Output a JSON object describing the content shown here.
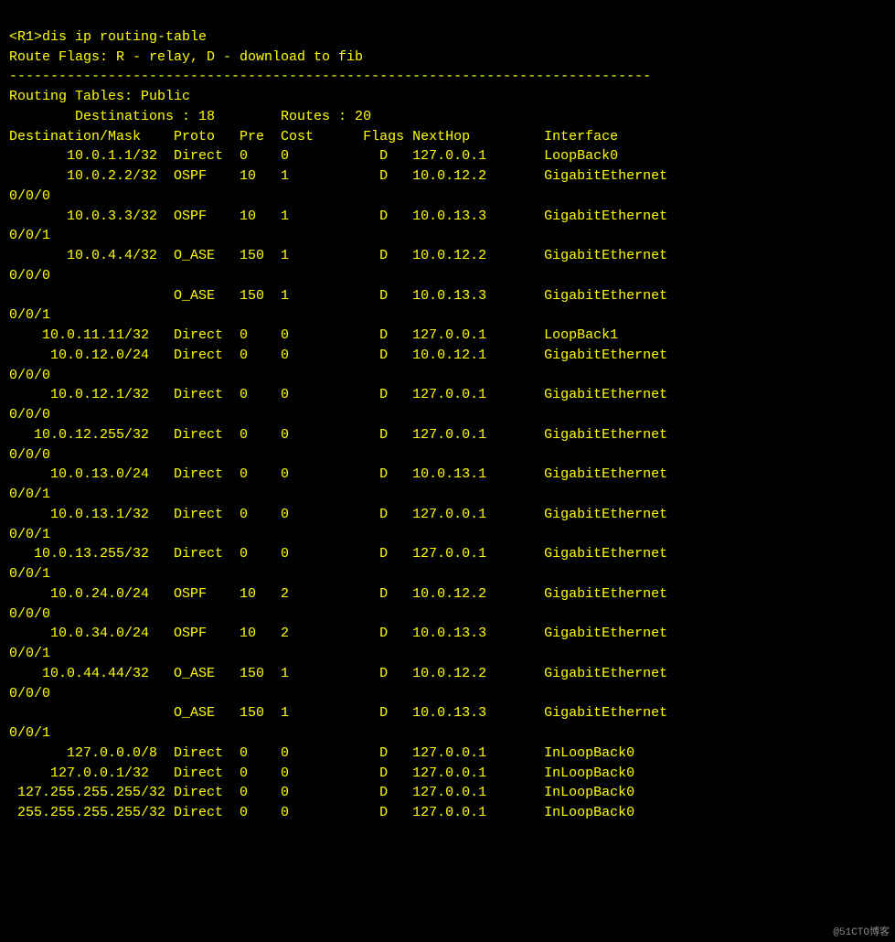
{
  "terminal": {
    "lines": [
      "<R1>dis ip routing-table",
      "Route Flags: R - relay, D - download to fib",
      "------------------------------------------------------------------------------",
      "Routing Tables: Public",
      "        Destinations : 18        Routes : 20",
      "",
      "Destination/Mask    Proto   Pre  Cost      Flags NextHop         Interface",
      "",
      "       10.0.1.1/32  Direct  0    0           D   127.0.0.1       LoopBack0",
      "       10.0.2.2/32  OSPF    10   1           D   10.0.12.2       GigabitEthernet",
      "0/0/0",
      "       10.0.3.3/32  OSPF    10   1           D   10.0.13.3       GigabitEthernet",
      "0/0/1",
      "       10.0.4.4/32  O_ASE   150  1           D   10.0.12.2       GigabitEthernet",
      "0/0/0",
      "                    O_ASE   150  1           D   10.0.13.3       GigabitEthernet",
      "0/0/1",
      "    10.0.11.11/32   Direct  0    0           D   127.0.0.1       LoopBack1",
      "     10.0.12.0/24   Direct  0    0           D   10.0.12.1       GigabitEthernet",
      "0/0/0",
      "     10.0.12.1/32   Direct  0    0           D   127.0.0.1       GigabitEthernet",
      "0/0/0",
      "   10.0.12.255/32   Direct  0    0           D   127.0.0.1       GigabitEthernet",
      "0/0/0",
      "     10.0.13.0/24   Direct  0    0           D   10.0.13.1       GigabitEthernet",
      "0/0/1",
      "     10.0.13.1/32   Direct  0    0           D   127.0.0.1       GigabitEthernet",
      "0/0/1",
      "   10.0.13.255/32   Direct  0    0           D   127.0.0.1       GigabitEthernet",
      "0/0/1",
      "     10.0.24.0/24   OSPF    10   2           D   10.0.12.2       GigabitEthernet",
      "0/0/0",
      "     10.0.34.0/24   OSPF    10   2           D   10.0.13.3       GigabitEthernet",
      "0/0/1",
      "    10.0.44.44/32   O_ASE   150  1           D   10.0.12.2       GigabitEthernet",
      "0/0/0",
      "                    O_ASE   150  1           D   10.0.13.3       GigabitEthernet",
      "0/0/1",
      "       127.0.0.0/8  Direct  0    0           D   127.0.0.1       InLoopBack0",
      "     127.0.0.1/32   Direct  0    0           D   127.0.0.1       InLoopBack0",
      " 127.255.255.255/32 Direct  0    0           D   127.0.0.1       InLoopBack0",
      " 255.255.255.255/32 Direct  0    0           D   127.0.0.1       InLoopBack0"
    ],
    "watermark": "@51CTO博客"
  }
}
